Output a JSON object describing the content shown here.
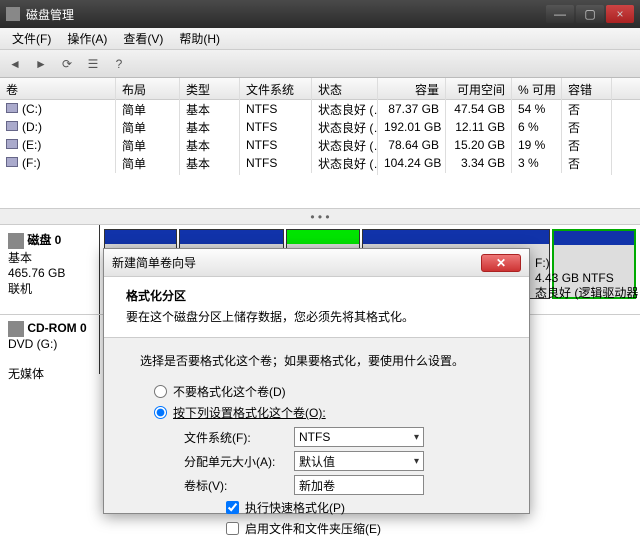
{
  "window": {
    "title": "磁盘管理",
    "min": "—",
    "max": "▢",
    "close": "×"
  },
  "menus": [
    "文件(F)",
    "操作(A)",
    "查看(V)",
    "帮助(H)"
  ],
  "cols": {
    "vol": "卷",
    "lay": "布局",
    "typ": "类型",
    "fs": "文件系统",
    "st": "状态",
    "cap": "容量",
    "free": "可用空间",
    "pct": "% 可用",
    "err": "容错"
  },
  "rows": [
    {
      "vol": "(C:)",
      "lay": "简单",
      "typ": "基本",
      "fs": "NTFS",
      "st": "状态良好 (…",
      "cap": "87.37 GB",
      "free": "47.54 GB",
      "pct": "54 %",
      "err": "否"
    },
    {
      "vol": "(D:)",
      "lay": "简单",
      "typ": "基本",
      "fs": "NTFS",
      "st": "状态良好 (…",
      "cap": "192.01 GB",
      "free": "12.11 GB",
      "pct": "6 %",
      "err": "否"
    },
    {
      "vol": "(E:)",
      "lay": "简单",
      "typ": "基本",
      "fs": "NTFS",
      "st": "状态良好 (…",
      "cap": "78.64 GB",
      "free": "15.20 GB",
      "pct": "19 %",
      "err": "否"
    },
    {
      "vol": "(F:)",
      "lay": "简单",
      "typ": "基本",
      "fs": "NTFS",
      "st": "状态良好 (…",
      "cap": "104.24 GB",
      "free": "3.34 GB",
      "pct": "3 %",
      "err": "否"
    }
  ],
  "disk0": {
    "name": "磁盘 0",
    "kind": "基本",
    "size": "465.76 GB",
    "status": "联机"
  },
  "cdrom": {
    "name": "CD-ROM 0",
    "sub": "DVD (G:)",
    "status": "无媒体"
  },
  "right": {
    "line1": "F:)",
    "line2": "4.43 GB NTFS",
    "line3": "态良好 (逻辑驱动器"
  },
  "wizard": {
    "title": "新建简单卷向导",
    "heading": "格式化分区",
    "sub": "要在这个磁盘分区上储存数据，您必须先将其格式化。",
    "intro": "选择是否要格式化这个卷；如果要格式化，要使用什么设置。",
    "opt1": "不要格式化这个卷(D)",
    "opt2": "按下列设置格式化这个卷(O):",
    "fs_lbl": "文件系统(F):",
    "fs_val": "NTFS",
    "au_lbl": "分配单元大小(A):",
    "au_val": "默认值",
    "vl_lbl": "卷标(V):",
    "vl_val": "新加卷",
    "chk1": "执行快速格式化(P)",
    "chk2": "启用文件和文件夹压缩(E)"
  }
}
